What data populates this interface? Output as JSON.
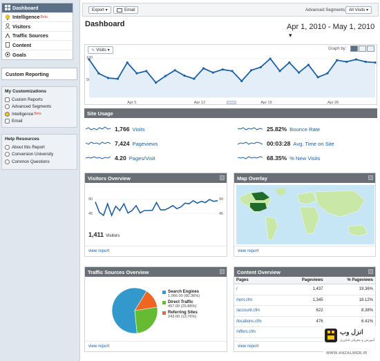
{
  "sidebar": {
    "nav": [
      {
        "label": "Dashboard",
        "icon": "dashboard-icon",
        "active": true,
        "beta": false
      },
      {
        "label": "Intelligence",
        "icon": "intelligence-icon",
        "active": false,
        "beta": true
      },
      {
        "label": "Visitors",
        "icon": "user-icon",
        "active": false,
        "beta": false
      },
      {
        "label": "Traffic Sources",
        "icon": "traffic-icon",
        "active": false,
        "beta": false
      },
      {
        "label": "Content",
        "icon": "page-icon",
        "active": false,
        "beta": false
      },
      {
        "label": "Goals",
        "icon": "goal-icon",
        "active": false,
        "beta": false
      }
    ],
    "beta_label": "Beta",
    "custom_reporting": "Custom Reporting",
    "customizations": {
      "title": "My Customizations",
      "items": [
        "Custom Reports",
        "Advanced Segments",
        "Intelligence",
        "Email"
      ]
    },
    "help": {
      "title": "Help Resources",
      "items": [
        "About this Report",
        "Conversion University",
        "Common Questions"
      ]
    }
  },
  "toolbar": {
    "export_label": "Export ▾",
    "email_label": "Email",
    "segments_label": "Advanced Segments:",
    "segments_value": "All Visits ▾"
  },
  "header": {
    "title": "Dashboard",
    "date_range": "Apr 1, 2010 - May 1, 2010"
  },
  "main_chart": {
    "metric_label": "Visits ▾",
    "graph_by_label": "Graph by:",
    "y_top": "100",
    "y_mid": "50",
    "x_labels": [
      "Apr 5",
      "Apr 12",
      "Apr 19",
      "Apr 26"
    ]
  },
  "site_usage": {
    "title": "Site Usage",
    "metrics": [
      {
        "value": "1,766",
        "label": "Visits"
      },
      {
        "value": "7,424",
        "label": "Pageviews"
      },
      {
        "value": "4.20",
        "label": "Pages/Visit"
      },
      {
        "value": "25.82%",
        "label": "Bounce Rate"
      },
      {
        "value": "00:03:28",
        "label": "Avg. Time on Site"
      },
      {
        "value": "68.35%",
        "label": "% New Visits"
      }
    ]
  },
  "visitors_overview": {
    "title": "Visitors Overview",
    "y_top": "90",
    "y_mid": "45",
    "total": "1,411",
    "total_label": "Visitors",
    "view_report": "view report"
  },
  "map_overlay": {
    "title": "Map Overlay",
    "view_report": "view report"
  },
  "traffic_sources": {
    "title": "Traffic Sources Overview",
    "view_report": "view report",
    "legend": [
      {
        "name": "Search Engines",
        "detail": "1,066.00 (60.36%)",
        "color": "#3399cc"
      },
      {
        "name": "Direct Traffic",
        "detail": "457.00 (25.88%)",
        "color": "#66bb33"
      },
      {
        "name": "Referring Sites",
        "detail": "243.00 (13.76%)",
        "color": "#ee6622"
      }
    ]
  },
  "content_overview": {
    "title": "Content Overview",
    "view_report": "view report",
    "headers": [
      "Pages",
      "Pageviews",
      "% Pageviews"
    ],
    "rows": [
      {
        "page": "/",
        "views": "1,437",
        "pct": "19.36%"
      },
      {
        "page": "/rent.cfm",
        "views": "1,345",
        "pct": "18.12%"
      },
      {
        "page": "/account.cfm",
        "views": "622",
        "pct": "8.38%"
      },
      {
        "page": "/locations.cfm",
        "views": "476",
        "pct": "6.41%"
      },
      {
        "page": "/offers.cfm",
        "views": "",
        "pct": ""
      }
    ]
  },
  "watermark": {
    "brand": "انزل وب",
    "tagline": "آموزش و معرفی فناوری",
    "url": "WWW.ANZALWEB.IR"
  },
  "chart_data": [
    {
      "type": "area",
      "title": "Visits",
      "x": [
        "Apr 1",
        "Apr 2",
        "Apr 3",
        "Apr 4",
        "Apr 5",
        "Apr 6",
        "Apr 7",
        "Apr 8",
        "Apr 9",
        "Apr 10",
        "Apr 11",
        "Apr 12",
        "Apr 13",
        "Apr 14",
        "Apr 15",
        "Apr 16",
        "Apr 17",
        "Apr 18",
        "Apr 19",
        "Apr 20",
        "Apr 21",
        "Apr 22",
        "Apr 23",
        "Apr 24",
        "Apr 25",
        "Apr 26",
        "Apr 27",
        "Apr 28",
        "Apr 29",
        "Apr 30",
        "May 1"
      ],
      "values": [
        98,
        62,
        50,
        48,
        90,
        62,
        68,
        38,
        55,
        70,
        56,
        48,
        75,
        64,
        72,
        68,
        42,
        70,
        78,
        100,
        68,
        90,
        64,
        84,
        52,
        62,
        96,
        92,
        98,
        92,
        90
      ],
      "ylim": [
        0,
        100
      ]
    },
    {
      "type": "line",
      "title": "Visitors Overview",
      "values": [
        82,
        48,
        38,
        76,
        38,
        68,
        54,
        76,
        46,
        54,
        70,
        46,
        54,
        54,
        55,
        80,
        56,
        56,
        62,
        70,
        60,
        66,
        78,
        76,
        86,
        78,
        84,
        80,
        90,
        84,
        86
      ],
      "ylim": [
        0,
        90
      ]
    },
    {
      "type": "pie",
      "title": "Traffic Sources Overview",
      "categories": [
        "Search Engines",
        "Direct Traffic",
        "Referring Sites"
      ],
      "values": [
        1066,
        457,
        243
      ]
    }
  ]
}
